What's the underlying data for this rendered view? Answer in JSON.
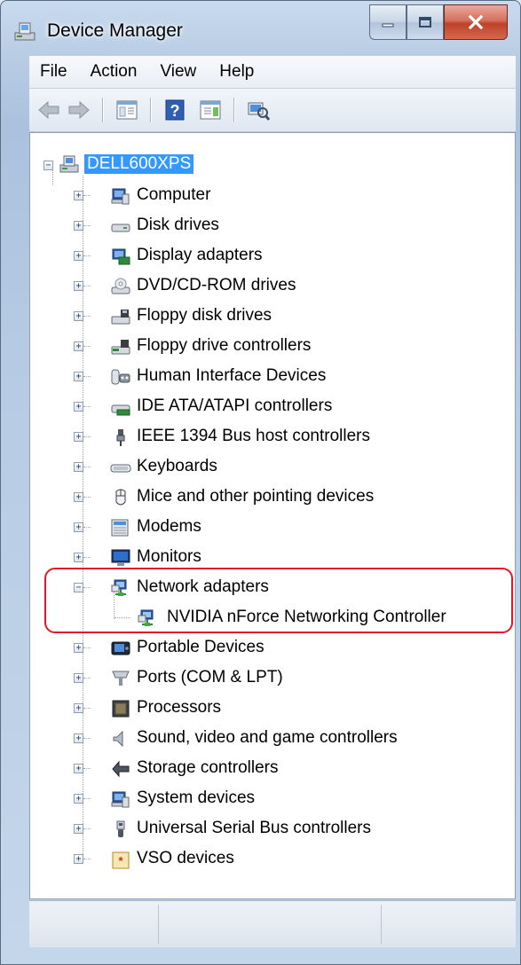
{
  "window": {
    "title": "Device Manager"
  },
  "menu": [
    "File",
    "Action",
    "View",
    "Help"
  ],
  "toolbar": {
    "buttons": [
      "back-icon",
      "forward-icon",
      "show-hide-tree-icon",
      "help-icon",
      "properties-icon",
      "scan-hardware-icon"
    ]
  },
  "tree": {
    "root": "DELL600XPS",
    "categories": [
      {
        "label": "Computer",
        "icon": "computer-icon"
      },
      {
        "label": "Disk drives",
        "icon": "disk-drive-icon"
      },
      {
        "label": "Display adapters",
        "icon": "display-adapter-icon"
      },
      {
        "label": "DVD/CD-ROM drives",
        "icon": "dvd-drive-icon"
      },
      {
        "label": "Floppy disk drives",
        "icon": "floppy-drive-icon"
      },
      {
        "label": "Floppy drive controllers",
        "icon": "floppy-controller-icon"
      },
      {
        "label": "Human Interface Devices",
        "icon": "hid-icon"
      },
      {
        "label": "IDE ATA/ATAPI controllers",
        "icon": "ide-controller-icon"
      },
      {
        "label": "IEEE 1394 Bus host controllers",
        "icon": "firewire-icon"
      },
      {
        "label": "Keyboards",
        "icon": "keyboard-icon"
      },
      {
        "label": "Mice and other pointing devices",
        "icon": "mouse-icon"
      },
      {
        "label": "Modems",
        "icon": "modem-icon"
      },
      {
        "label": "Monitors",
        "icon": "monitor-icon"
      },
      {
        "label": "Network adapters",
        "icon": "network-adapter-icon",
        "expanded": true,
        "children": [
          {
            "label": "NVIDIA nForce Networking Controller",
            "icon": "network-adapter-icon"
          }
        ]
      },
      {
        "label": "Portable Devices",
        "icon": "portable-device-icon"
      },
      {
        "label": "Ports (COM & LPT)",
        "icon": "port-icon"
      },
      {
        "label": "Processors",
        "icon": "processor-icon"
      },
      {
        "label": "Sound, video and game controllers",
        "icon": "sound-icon"
      },
      {
        "label": "Storage controllers",
        "icon": "storage-controller-icon"
      },
      {
        "label": "System devices",
        "icon": "system-device-icon"
      },
      {
        "label": "Universal Serial Bus controllers",
        "icon": "usb-icon"
      },
      {
        "label": "VSO devices",
        "icon": "vso-device-icon"
      }
    ]
  },
  "colors": {
    "selection": "#3399ff",
    "highlight_ring": "#e0182a"
  }
}
